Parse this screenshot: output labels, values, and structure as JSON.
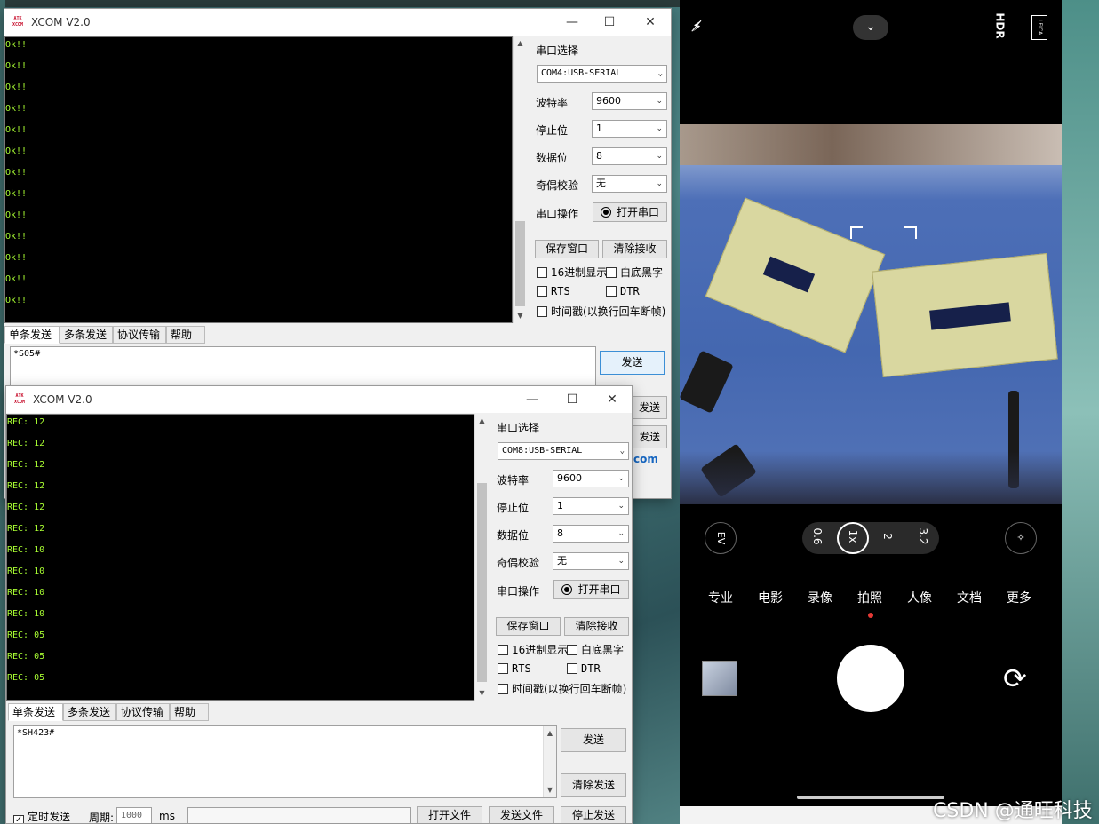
{
  "windows": [
    {
      "title": "XCOM V2.0",
      "logo": "ATK XCOM",
      "receive_lines": [
        "Ok!!",
        "Ok!!",
        "Ok!!",
        "Ok!!",
        "Ok!!",
        "Ok!!",
        "Ok!!",
        "Ok!!",
        "Ok!!",
        "Ok!!",
        "Ok!!",
        "Ok!!",
        "Ok!!"
      ],
      "port_label": "串口选择",
      "port_value": "COM4:USB-SERIAL",
      "baud_label": "波特率",
      "baud_value": "9600",
      "stop_label": "停止位",
      "stop_value": "1",
      "data_label": "数据位",
      "data_value": "8",
      "parity_label": "奇偶校验",
      "parity_value": "无",
      "op_label": "串口操作",
      "open_btn": "打开串口",
      "save_btn": "保存窗口",
      "clear_btn": "清除接收",
      "hex_chk": "16进制显示",
      "white_chk": "白底黑字",
      "rts_chk": "RTS",
      "dtr_chk": "DTR",
      "time_chk": "时间戳(以换行回车断帧)",
      "tabs": [
        "单条发送",
        "多条发送",
        "协议传输",
        "帮助"
      ],
      "send_text": "*S05#",
      "send_btn": "发送",
      "send_btn_partial": "发送",
      "clear_send_partial": "发送",
      "url_partial": "com"
    },
    {
      "title": "XCOM V2.0",
      "logo": "ATK XCOM",
      "receive_lines": [
        "REC: 12",
        "REC: 12",
        "REC: 12",
        "REC: 12",
        "REC: 12",
        "REC: 12",
        "REC: 10",
        "REC: 10",
        "REC: 10",
        "REC: 10",
        "REC: 05",
        "REC: 05",
        "REC: 05"
      ],
      "port_label": "串口选择",
      "port_value": "COM8:USB-SERIAL",
      "baud_label": "波特率",
      "baud_value": "9600",
      "stop_label": "停止位",
      "stop_value": "1",
      "data_label": "数据位",
      "data_value": "8",
      "parity_label": "奇偶校验",
      "parity_value": "无",
      "op_label": "串口操作",
      "open_btn": "打开串口",
      "save_btn": "保存窗口",
      "clear_btn": "清除接收",
      "hex_chk": "16进制显示",
      "white_chk": "白底黑字",
      "rts_chk": "RTS",
      "dtr_chk": "DTR",
      "time_chk": "时间戳(以换行回车断帧)",
      "tabs": [
        "单条发送",
        "多条发送",
        "协议传输",
        "帮助"
      ],
      "send_text": "*SH423#",
      "send_btn": "发送",
      "clear_send_btn": "清除发送",
      "timed_send": "定时发送",
      "period_label": "周期:",
      "period_value": "1000",
      "period_unit": "ms",
      "open_file_btn": "打开文件",
      "send_file_btn": "发送文件",
      "stop_send_btn": "停止发送"
    }
  ],
  "camera": {
    "hdr_label": "HDR",
    "leica_label": "LEICA",
    "ev_label": "EV",
    "zoom_levels": [
      "0.6",
      "1x",
      "2",
      "3.2"
    ],
    "modes": [
      "专业",
      "电影",
      "录像",
      "拍照",
      "人像",
      "文档",
      "更多"
    ],
    "active_mode": "拍照"
  },
  "watermark": "CSDN @通旺科技",
  "colors": {
    "terminal_text": "#aaff33",
    "terminal_bg": "#000000",
    "active_mode_dot": "#e53935"
  }
}
